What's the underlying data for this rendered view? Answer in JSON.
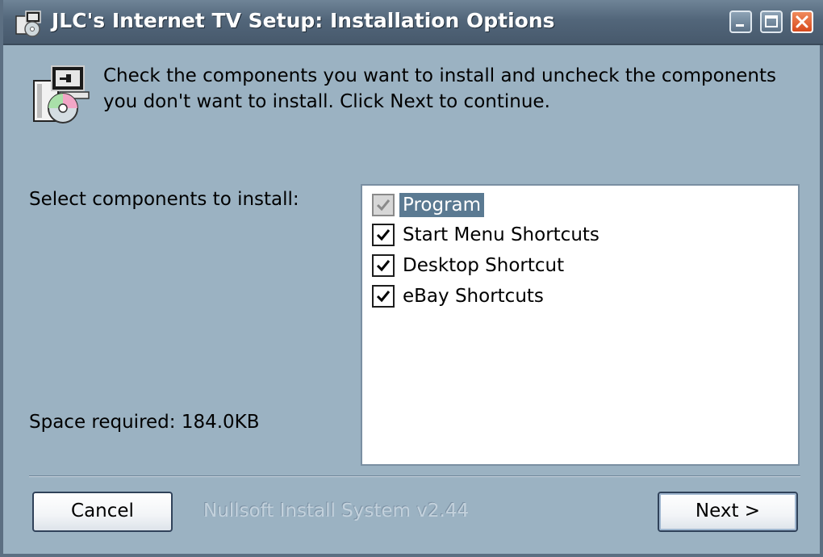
{
  "window": {
    "title": "JLC's Internet TV Setup: Installation Options"
  },
  "header": {
    "description": "Check the components you want to install and uncheck the components you don't want to install. Click Next to continue."
  },
  "components": {
    "select_label": "Select components to install:",
    "space_required": "Space required: 184.0KB",
    "items": [
      {
        "label": "Program",
        "checked": true,
        "disabled": true,
        "selected": true
      },
      {
        "label": "Start Menu Shortcuts",
        "checked": true,
        "disabled": false,
        "selected": false
      },
      {
        "label": "Desktop Shortcut",
        "checked": true,
        "disabled": false,
        "selected": false
      },
      {
        "label": "eBay Shortcuts",
        "checked": true,
        "disabled": false,
        "selected": false
      }
    ]
  },
  "footer": {
    "cancel_label": "Cancel",
    "branding": "Nullsoft Install System v2.44",
    "next_label": "Next >"
  },
  "icons": {
    "app": "installer-icon",
    "header": "installer-icon",
    "minimize": "minimize-icon",
    "maximize": "maximize-icon",
    "close": "close-icon",
    "check": "checkmark-icon"
  },
  "colors": {
    "window_bg": "#9bb2c2",
    "selection": "#5b7a92",
    "close_button": "#d74a1d"
  }
}
